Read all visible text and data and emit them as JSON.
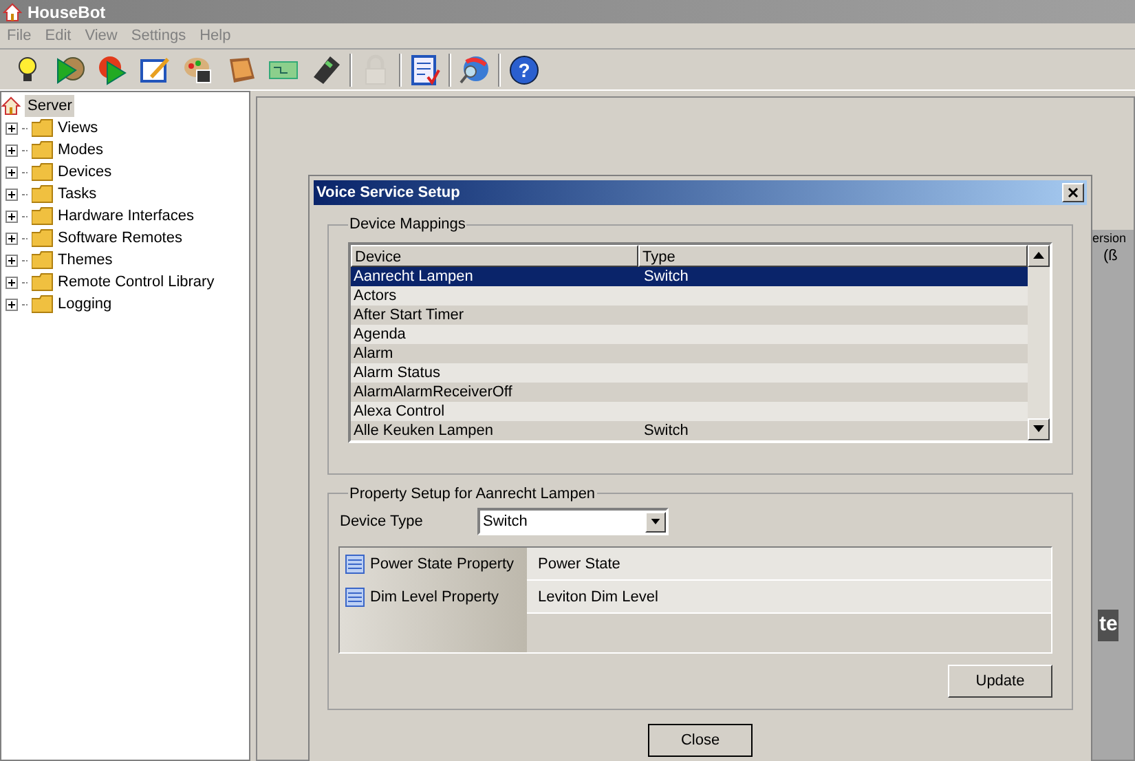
{
  "app": {
    "title": "HouseBot"
  },
  "menu": [
    "File",
    "Edit",
    "View",
    "Settings",
    "Help"
  ],
  "toolbar": [
    {
      "disabled": false
    },
    {
      "disabled": false
    },
    {
      "disabled": false
    },
    {
      "disabled": false
    },
    {
      "disabled": false
    },
    {
      "disabled": false
    },
    {
      "disabled": false
    },
    {
      "disabled": false
    },
    {
      "disabled": true
    },
    {
      "disabled": false
    },
    {
      "disabled": false
    },
    {
      "disabled": false,
      "glyph": "?"
    }
  ],
  "tree": {
    "label": "Server",
    "selected": true,
    "children": [
      {
        "label": "Views",
        "expanded": false
      },
      {
        "label": "Modes",
        "expanded": false
      },
      {
        "label": "Devices",
        "expanded": false
      },
      {
        "label": "Tasks",
        "expanded": false
      },
      {
        "label": "Hardware Interfaces",
        "expanded": false
      },
      {
        "label": "Software Remotes",
        "expanded": false
      },
      {
        "label": "Themes",
        "expanded": false
      },
      {
        "label": "Remote Control Library",
        "expanded": false
      },
      {
        "label": "Logging",
        "expanded": false
      }
    ]
  },
  "background": {
    "texts": [
      "ersion",
      "(ß",
      "te"
    ]
  },
  "dialog": {
    "title": "Voice Service Setup",
    "mappings": {
      "legend": "Device Mappings",
      "columns": [
        "Device",
        "Type"
      ],
      "rows": [
        {
          "device": "Aanrecht Lampen",
          "type": "Switch",
          "selected": true
        },
        {
          "device": "Actors",
          "selected": false
        },
        {
          "device": "After Start Timer",
          "selected": false
        },
        {
          "device": "Agenda",
          "selected": false
        },
        {
          "device": "Alarm",
          "selected": false
        },
        {
          "device": "Alarm Status",
          "selected": false
        },
        {
          "device": "AlarmAlarmReceiverOff",
          "selected": false
        },
        {
          "device": "Alexa Control",
          "selected": false
        },
        {
          "device": "Alle Keuken Lampen",
          "type": "Switch",
          "selected": false
        }
      ]
    },
    "property_setup": {
      "legend": "Property Setup for Aanrecht Lampen",
      "device_type_label": "Device Type",
      "device_type": "Switch",
      "properties": [
        {
          "name": "Power State Property",
          "value": "Power State"
        },
        {
          "name": "Dim Level Property",
          "value": "Leviton Dim Level"
        }
      ],
      "update_button": "Update"
    },
    "close_button": "Close"
  }
}
